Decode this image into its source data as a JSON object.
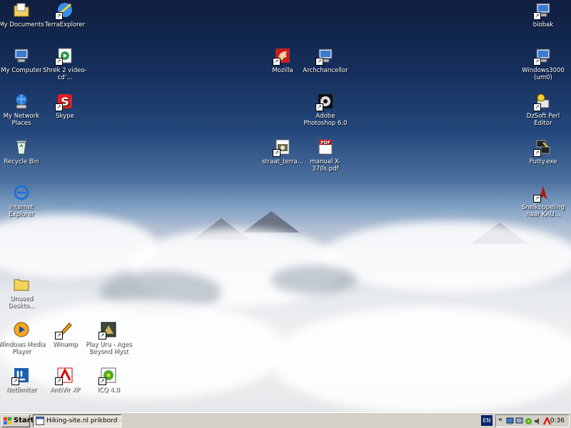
{
  "desktop": {
    "icons": [
      {
        "label": "My Documents",
        "icon": "folder-docs-icon"
      },
      {
        "label": "TerraExplorer",
        "icon": "globe-app-icon"
      },
      {
        "label": "My Computer",
        "icon": "computer-icon"
      },
      {
        "label": "Shrek 2 video-cd'...",
        "icon": "media-file-icon"
      },
      {
        "label": "My Network Places",
        "icon": "network-icon"
      },
      {
        "label": "Skype",
        "icon": "skype-icon"
      },
      {
        "label": "Recycle Bin",
        "icon": "recycle-bin-icon"
      },
      {
        "label": "Internet Explorer",
        "icon": "ie-icon"
      },
      {
        "label": "Unused Deskto...",
        "icon": "folder-icon"
      },
      {
        "label": "Windows Media Player",
        "icon": "media-player-icon"
      },
      {
        "label": "Winamp",
        "icon": "winamp-icon"
      },
      {
        "label": "Play Uru - Ages Beyond Myst",
        "icon": "game-icon"
      },
      {
        "label": "Netlimiter",
        "icon": "netlimiter-icon"
      },
      {
        "label": "AntiVir XP",
        "icon": "antivir-icon"
      },
      {
        "label": "ICQ 4.0",
        "icon": "icq-icon"
      },
      {
        "label": "Mozilla",
        "icon": "mozilla-icon"
      },
      {
        "label": "Archchancellor",
        "icon": "computer-icon"
      },
      {
        "label": "Adobe Photoshop 6.0",
        "icon": "photoshop-icon"
      },
      {
        "label": "straat_terra...",
        "icon": "image-file-icon"
      },
      {
        "label": "manual X-370s.pdf",
        "icon": "pdf-icon"
      },
      {
        "label": "biobak",
        "icon": "computer-icon"
      },
      {
        "label": "Windows3000 (um0)",
        "icon": "computer-icon"
      },
      {
        "label": "DzSoft Perl Editor",
        "icon": "perl-editor-icon"
      },
      {
        "label": "Putty.exe",
        "icon": "putty-icon"
      },
      {
        "label": "Snelkoppeling naar KAU...",
        "icon": "kau-icon"
      }
    ]
  },
  "taskbar": {
    "start_label": "Start",
    "task_label": "Hiking-site.nl prikbord - ...",
    "language": "EN",
    "tray_chevron": "«",
    "clock": "0:36"
  },
  "colors": {
    "taskbar": "#d4d0c8",
    "language_bg": "#0a246a"
  }
}
